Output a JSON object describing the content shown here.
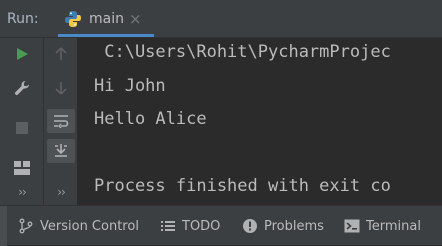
{
  "run_panel": {
    "title": "Run:",
    "tab": {
      "label": "main",
      "icon": "python-icon",
      "close": "×"
    }
  },
  "toolbar_left": {
    "rerun": "rerun-icon",
    "settings": "wrench-icon",
    "stop": "stop-icon",
    "layout": "layout-icon",
    "more": "››"
  },
  "toolbar_right": {
    "up": "up-arrow-icon",
    "down": "down-arrow-icon",
    "soft_wrap": "soft-wrap-icon",
    "scroll_end": "scroll-to-end-icon",
    "more": "››"
  },
  "console": {
    "lines": [
      " C:\\Users\\Rohit\\PycharmProjec",
      "Hi John",
      "Hello Alice",
      "",
      "Process finished with exit co"
    ]
  },
  "bottom_bar": {
    "items": [
      {
        "label": "Version Control",
        "icon": "branch-icon"
      },
      {
        "label": "TODO",
        "icon": "list-icon"
      },
      {
        "label": "Problems",
        "icon": "info-icon"
      },
      {
        "label": "Terminal",
        "icon": "terminal-icon"
      }
    ]
  },
  "colors": {
    "panel_bg": "#3c3f41",
    "console_bg": "#2b2b2b",
    "accent": "#4a88c7",
    "run_green": "#499c54"
  }
}
